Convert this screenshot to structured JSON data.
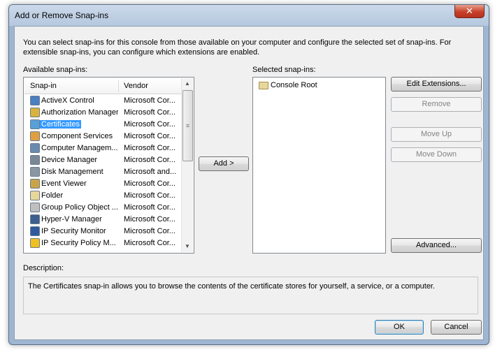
{
  "window": {
    "title": "Add or Remove Snap-ins",
    "close_glyph": "✕"
  },
  "intro": "You can select snap-ins for this console from those available on your computer and configure the selected set of snap-ins. For extensible snap-ins, you can configure which extensions are enabled.",
  "available": {
    "label": "Available snap-ins:",
    "columns": {
      "snapin": "Snap-in",
      "vendor": "Vendor"
    },
    "rows": [
      {
        "name": "ActiveX Control",
        "vendor": "Microsoft Cor...",
        "icon": "activex-icon"
      },
      {
        "name": "Authorization Manager",
        "vendor": "Microsoft Cor...",
        "icon": "authorization-icon"
      },
      {
        "name": "Certificates",
        "vendor": "Microsoft Cor...",
        "icon": "certificates-icon"
      },
      {
        "name": "Component Services",
        "vendor": "Microsoft Cor...",
        "icon": "component-services-icon"
      },
      {
        "name": "Computer Managem...",
        "vendor": "Microsoft Cor...",
        "icon": "computer-management-icon"
      },
      {
        "name": "Device Manager",
        "vendor": "Microsoft Cor...",
        "icon": "device-manager-icon"
      },
      {
        "name": "Disk Management",
        "vendor": "Microsoft and...",
        "icon": "disk-management-icon"
      },
      {
        "name": "Event Viewer",
        "vendor": "Microsoft Cor...",
        "icon": "event-viewer-icon"
      },
      {
        "name": "Folder",
        "vendor": "Microsoft Cor...",
        "icon": "folder-icon"
      },
      {
        "name": "Group Policy Object ...",
        "vendor": "Microsoft Cor...",
        "icon": "group-policy-icon"
      },
      {
        "name": "Hyper-V Manager",
        "vendor": "Microsoft Cor...",
        "icon": "hyper-v-icon"
      },
      {
        "name": "IP Security Monitor",
        "vendor": "Microsoft Cor...",
        "icon": "ip-security-monitor-icon"
      },
      {
        "name": "IP Security Policy M...",
        "vendor": "Microsoft Cor...",
        "icon": "ip-security-policy-icon"
      }
    ],
    "selected_index": 2
  },
  "add_button": "Add >",
  "selected": {
    "label": "Selected snap-ins:",
    "items": [
      {
        "name": "Console Root",
        "icon": "folder-icon"
      }
    ]
  },
  "buttons": {
    "edit_extensions": "Edit Extensions...",
    "remove": "Remove",
    "move_up": "Move Up",
    "move_down": "Move Down",
    "advanced": "Advanced...",
    "ok": "OK",
    "cancel": "Cancel"
  },
  "description": {
    "label": "Description:",
    "text": "The Certificates snap-in allows you to browse the contents of the certificate stores for yourself, a service, or a computer."
  },
  "icon_colors": {
    "activex": "#4a7fc1",
    "authorization": "#d8b23a",
    "certificates": "#5aa0d8",
    "component": "#e0a040",
    "computer": "#6a8bb0",
    "device": "#7a8896",
    "disk": "#8a96a2",
    "event": "#c9a447",
    "folder": "#e8d79a",
    "policy": "#bfbfbf",
    "hyperv": "#3c5f8f",
    "ipmon": "#2f5a9e",
    "ippol": "#f0c020"
  }
}
